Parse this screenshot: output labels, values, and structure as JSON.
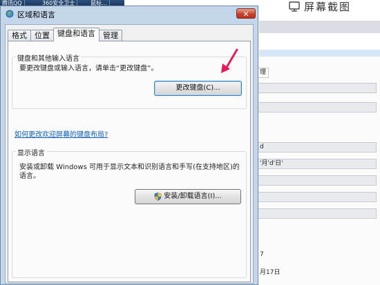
{
  "background": {
    "taskbar": [
      "腾讯QQ",
      "360安全卫士",
      "鼠标…"
    ],
    "capture_label": "屏幕截图",
    "fields": [
      "理",
      "d",
      "'月'd'日'"
    ],
    "texts": [
      "7",
      "月17日"
    ]
  },
  "dialog": {
    "title": "区域和语言",
    "close_glyph": "✕",
    "tabs": [
      "格式",
      "位置",
      "键盘和语言",
      "管理"
    ],
    "active_tab": "键盘和语言",
    "keyboard_group": {
      "title": "键盘和其他输入语言",
      "description": "要更改键盘或输入语言，请单击“更改键盘”。",
      "button": "更改键盘(C)..."
    },
    "help_link": "如何更改欢迎屏幕的键盘布局?",
    "display_group": {
      "title": "显示语言",
      "description": "安装或卸载 Windows 可用于显示文本和识别语言和手写(在支持地区)的语言。",
      "button": "安装/卸载语言(I)...",
      "button_icon": "uac-shield-icon"
    }
  },
  "annotation": {
    "color": "#e8195a"
  }
}
